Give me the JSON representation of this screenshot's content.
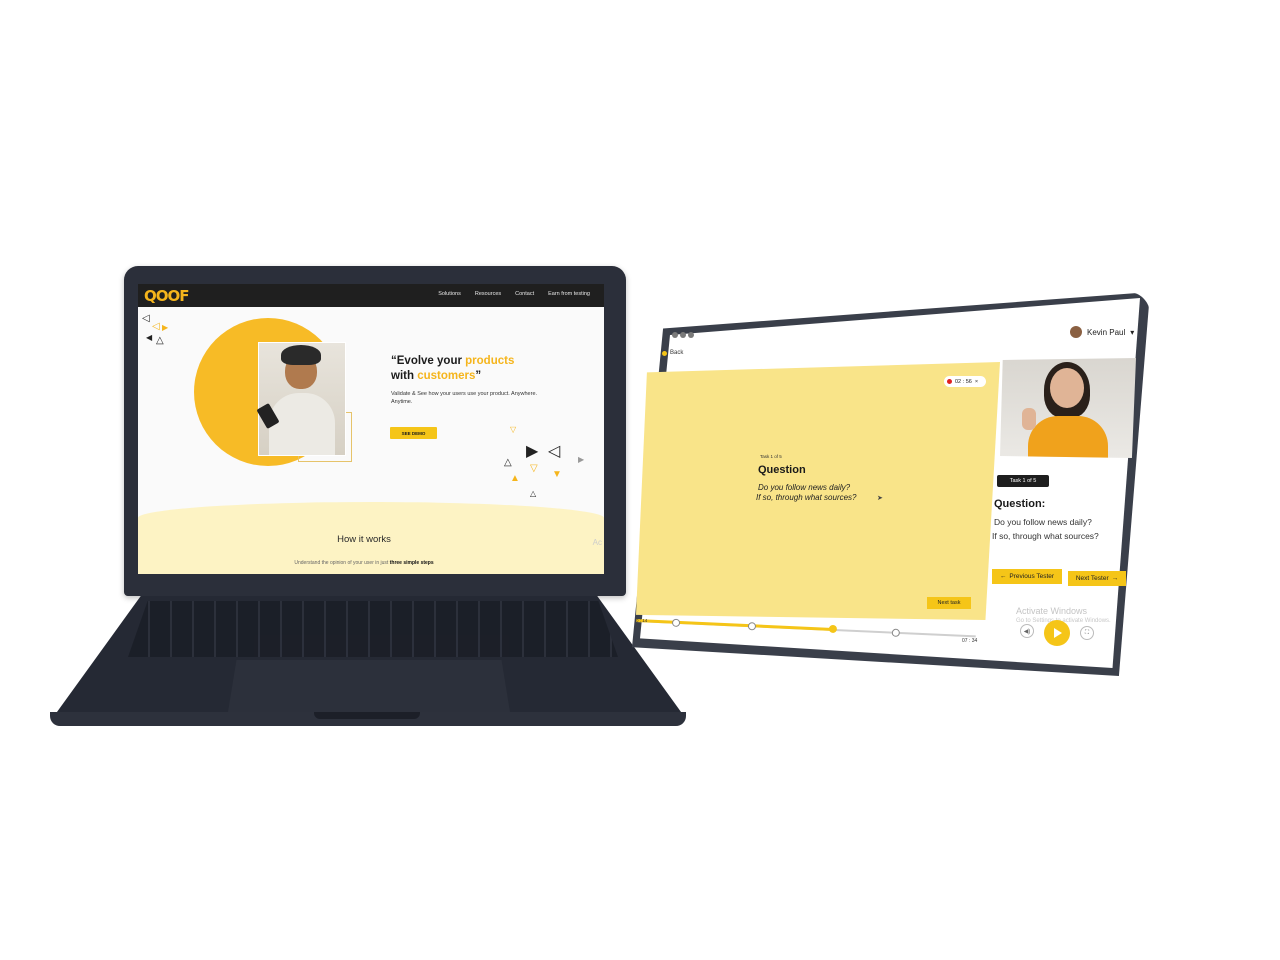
{
  "laptop": {
    "site": {
      "logo": "QOOF",
      "nav": [
        "Solutions",
        "Resources",
        "Contact",
        "Earn from testing"
      ],
      "hero_title_prefix": "“Evolve your ",
      "hero_title_hl1": "products",
      "hero_title_mid": " with ",
      "hero_title_hl2": "customers",
      "hero_title_suffix": "”",
      "hero_sub": "Validate & See how your users use your product. Anywhere. Anytime.",
      "cta": "SEE DEMO",
      "how_title": "How it works",
      "how_sub_prefix": "Understand the opinion of your user in just ",
      "how_sub_bold": "three simple steps",
      "ghost": "Ac"
    },
    "colors": {
      "accent": "#f5b51c",
      "nav_bg": "#1f1f1f",
      "wave": "#fdf3c4"
    }
  },
  "tablet": {
    "back": "Back",
    "user": "Kevin Paul",
    "timer": "02 : 56",
    "task_small": "Task 1 of 5",
    "task_title": "Question",
    "task_line1": "Do you follow news daily?",
    "task_line2": "If so, through what sources?",
    "next_task": "Next task",
    "time_start": "0 : 14",
    "time_end": "07 : 34",
    "badge": "Task 1 of 5",
    "side_title": "Question:",
    "side_line1": "Do you follow news daily?",
    "side_line2": "If so, through what sources?",
    "prev_tester": "Previous Tester",
    "next_tester": "Next Tester",
    "activate": "Activate Windows",
    "activate_sub": "Go to Settings to activate Windows.",
    "progress": 0.58,
    "colors": {
      "panel": "#f9e489",
      "accent": "#f5c518"
    }
  }
}
